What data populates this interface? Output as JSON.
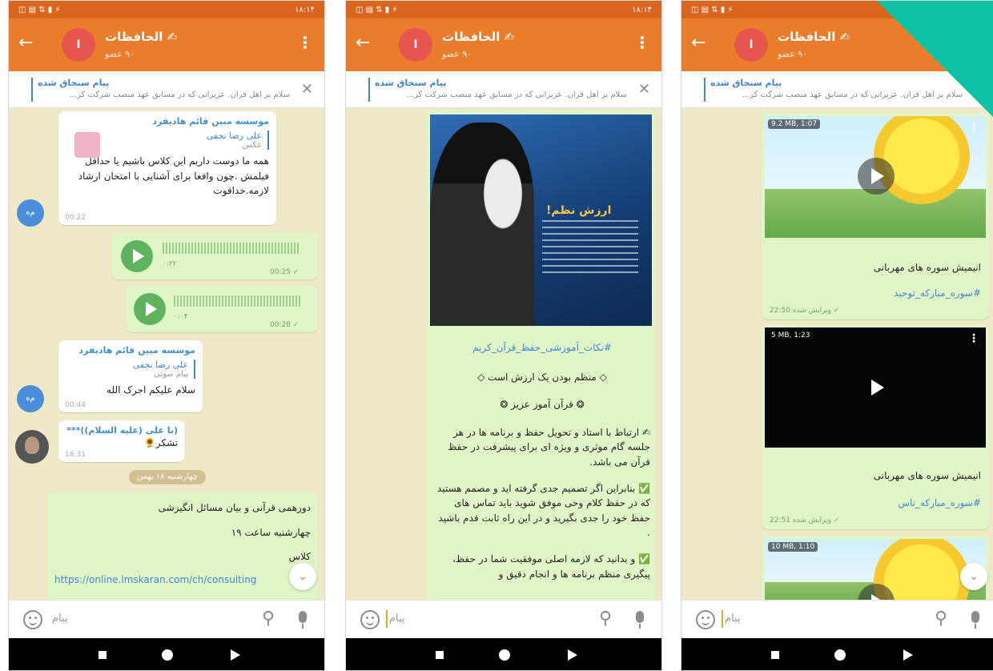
{
  "status_bar": {
    "time": "۱۸:۱۴"
  },
  "header": {
    "title": "✍ الحافظات",
    "subtitle": "۹۰ عضو",
    "avatar_letter": "ا"
  },
  "pinned": {
    "title": "پیام سنجاق شده",
    "text": "سلام بر اهل قرآن. عزیزانی که در مسابق عهد منصب شرکت کر..."
  },
  "composer": {
    "placeholder": "پیام"
  },
  "phone1": {
    "msg1": {
      "sender": "موسسه مبین قائم هادیفرد",
      "reply_name": "علی رضا نجفی",
      "reply_text": "عکس",
      "text": "همه ما دوست داریم این کلاس باشیم یا حداقل فیلمش .چون واقعا برای آشنایی با امتحان ارشاد لازمه.خداقوت",
      "time": "00:22",
      "avatar": "م‌ه"
    },
    "voice1": {
      "length": "۰:۲۲",
      "time": "00:25 ✓"
    },
    "voice2": {
      "length": "۰:۰۴",
      "time": "00:28 ✓"
    },
    "msg2": {
      "sender": "موسسه مبین قائم هادیفرد",
      "reply_name": "علی رضا نجفی",
      "reply_text": "پیام صوتی",
      "text": "سلام علیکم اجرک الله",
      "time": "00:44",
      "avatar": "م‌ه"
    },
    "msg3": {
      "sender": "(با علی (علیه السلام))***",
      "text": "تشکر🌻",
      "time": "18:31"
    },
    "date_pill": "چهارشنبه ۱۸ بهمن",
    "msg4": {
      "line1": "دورهمی قرآنی و بیان مسائل انگیزشی",
      "line2": "چهارشنبه ساعت ۱۹",
      "line3": "کلاس",
      "link": "https://online.lmskaran.com/ch/consulting"
    }
  },
  "phone2": {
    "poster_title": "ارزش نظم!",
    "hashtag": "#نکات_آموزشی_حفظ_قرآن_کریم",
    "line1": "◇ منظم بودن یک ارزش است ◇",
    "line2": "❂ قرآن آموز عزیز ❂",
    "para1": "✍ ارتباط با استاد و تحویل حفظ و برنامه ها در هر جلسه گام موثری و ویژه ای برای پیشرفت در حفظ قرآن می باشد.",
    "para2": "✅ بنابراین اگر تصمیم جدی گرفته اید و مصمم هستید که در حفظ کلام وحی موفق شوید باید تماس های حفظ خود را جدی بگیرید و در این راه ثابت قدم باشید .",
    "para3": "✅ و بدانید که لازمه اصلی موفقیت شما در حفظ، پیگیری منظم برنامه ها و انجام دقیق و"
  },
  "phone3": {
    "video1": {
      "badge": "9.2 MB, 1:07",
      "caption": "انیمیش سوره های مهربانی",
      "tag": "#سوره_مبارکه_توحید",
      "time": "ویرایش شده 22:50 ✓"
    },
    "video2": {
      "badge": "5 MB, 1:23",
      "caption": "انیمیش سوره های مهربانی",
      "tag": "#سوره_مبارکه_ناس",
      "time": "ویرایش شده 22:51 ✓"
    },
    "video3": {
      "badge": "10 MB, 1:10"
    }
  },
  "colors": {
    "header": "#ea7d2b",
    "status": "#d9651f",
    "chat_bg": "#efe9c8",
    "out_bubble": "#e0f6c7",
    "accent": "#3f86d6",
    "corner": "#0fc2a6"
  },
  "icons": [
    "back-arrow-icon",
    "more-vert-icon",
    "close-icon",
    "play-icon",
    "emoji-icon",
    "attach-icon",
    "mic-icon",
    "chevron-down-icon",
    "nav-back-icon",
    "nav-home-icon",
    "nav-recents-icon"
  ]
}
